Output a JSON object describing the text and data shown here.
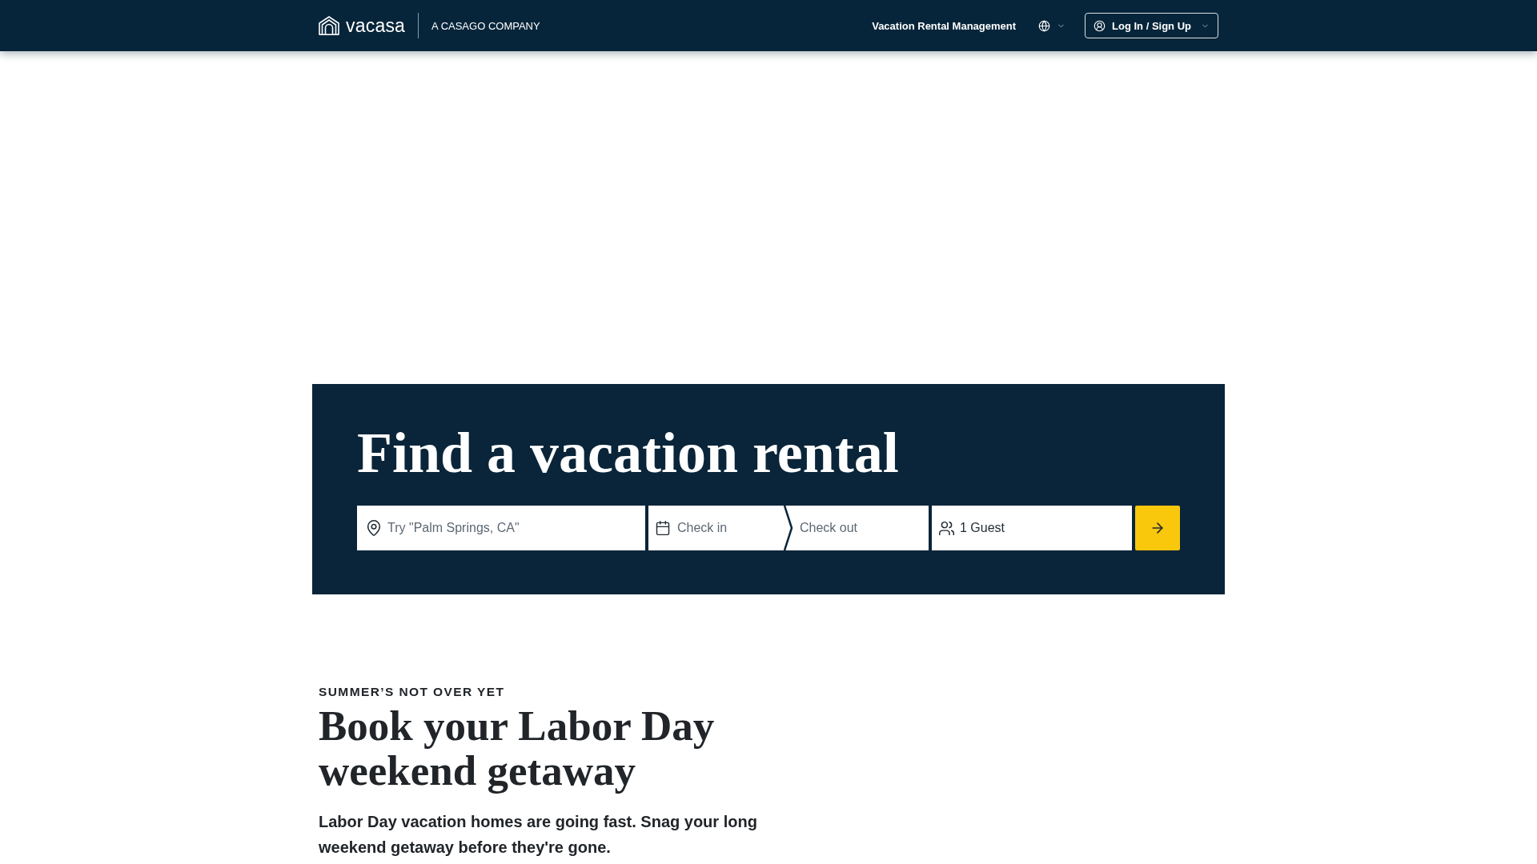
{
  "header": {
    "logo_text": "vacasa",
    "tagline": "A CASAGO COMPANY",
    "nav_link": "Vacation Rental Management",
    "login_button": "Log In / Sign Up"
  },
  "search_panel": {
    "title": "Find a vacation rental",
    "location": {
      "placeholder": "Try \"Palm Springs, CA\""
    },
    "check_in": {
      "placeholder": "Check in"
    },
    "check_out": {
      "placeholder": "Check out"
    },
    "guests": {
      "value": "1 Guest"
    }
  },
  "promo": {
    "eyebrow": "SUMMER’S NOT OVER YET",
    "heading": "Book your Labor Day weekend getaway",
    "body": "Labor Day vacation homes are going fast. Snag your long weekend getaway before they're gone."
  }
}
